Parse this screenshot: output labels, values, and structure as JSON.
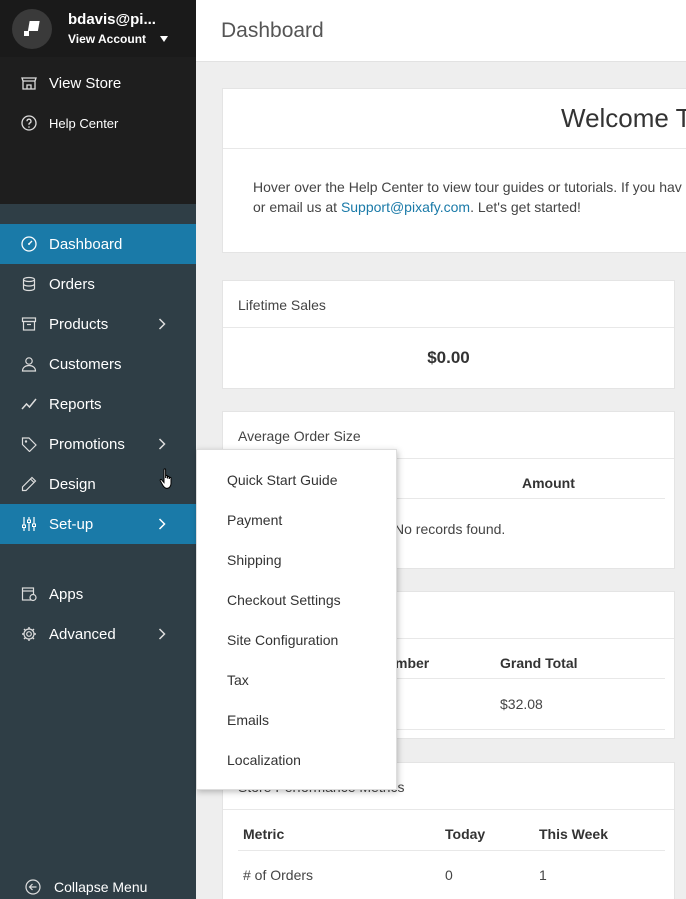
{
  "account": {
    "name": "bdavis@pi...",
    "view_label": "View Account"
  },
  "top_links": [
    {
      "label": "View Store",
      "icon": "store-icon"
    },
    {
      "label": "Help Center",
      "icon": "help-icon"
    }
  ],
  "nav": {
    "dashboard": "Dashboard",
    "orders": "Orders",
    "products": "Products",
    "customers": "Customers",
    "reports": "Reports",
    "promotions": "Promotions",
    "design": "Design",
    "setup": "Set-up",
    "apps": "Apps",
    "advanced": "Advanced",
    "collapse": "Collapse Menu"
  },
  "header": {
    "title": "Dashboard"
  },
  "welcome": {
    "title": "Welcome T",
    "line1": "Hover over the Help Center to view tour guides or tutorials. If you hav",
    "line2_prefix": "or email us at ",
    "email": "Support@pixafy.com",
    "line2_suffix": ". Let's get started!"
  },
  "lifetime_sales": {
    "title": "Lifetime Sales",
    "value": "$0.00"
  },
  "avg_order_size": {
    "title": "Average Order Size",
    "col_amount": "Amount",
    "empty": "No records found."
  },
  "orders_card": {
    "col_number": "mber",
    "col_grand_total": "Grand Total",
    "row_total": "$32.08"
  },
  "store_metrics": {
    "title": "Store Performance Metrics",
    "columns": [
      "Metric",
      "Today",
      "This Week"
    ],
    "rows": [
      [
        "# of Orders",
        "0",
        "1"
      ]
    ]
  },
  "setup_submenu": [
    "Quick Start Guide",
    "Payment",
    "Shipping",
    "Checkout Settings",
    "Site Configuration",
    "Tax",
    "Emails",
    "Localization"
  ],
  "colors": {
    "sidebar": "#2f3e46",
    "active": "#1a7aa8",
    "account_bar": "#1a1a1a",
    "link": "#1a7aa8"
  }
}
